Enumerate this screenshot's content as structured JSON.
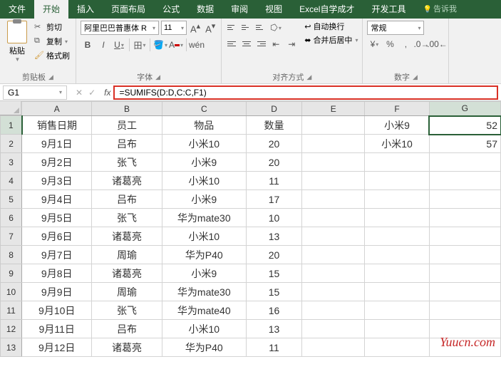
{
  "tabs": {
    "file": "文件",
    "home": "开始",
    "insert": "插入",
    "layout": "页面布局",
    "formulas": "公式",
    "data": "数据",
    "review": "审阅",
    "view": "视图",
    "addin": "Excel自学成才",
    "dev": "开发工具",
    "tell": "告诉我"
  },
  "ribbon": {
    "paste": "粘贴",
    "cut": "剪切",
    "copy": "复制",
    "format_painter": "格式刷",
    "clipboard_label": "剪贴板",
    "font_name": "阿里巴巴普惠体 R",
    "font_size": "11",
    "font_label": "字体",
    "wrap": "自动换行",
    "merge": "合并后居中",
    "align_label": "对齐方式",
    "number_format": "常规",
    "number_label": "数字"
  },
  "formula_bar": {
    "name_box": "G1",
    "formula": "=SUMIFS(D:D,C:C,F1)"
  },
  "columns": [
    "A",
    "B",
    "C",
    "D",
    "E",
    "F",
    "G"
  ],
  "rows_header": [
    "1",
    "2",
    "3",
    "4",
    "5",
    "6",
    "7",
    "8",
    "9",
    "10",
    "11",
    "12",
    "13"
  ],
  "headers": {
    "a": "销售日期",
    "b": "员工",
    "c": "物品",
    "d": "数量"
  },
  "side": {
    "f1": "小米9",
    "g1": "52",
    "f2": "小米10",
    "g2": "57"
  },
  "data_rows": [
    {
      "date": "9月1日",
      "emp": "吕布",
      "item": "小米10",
      "qty": "20"
    },
    {
      "date": "9月2日",
      "emp": "张飞",
      "item": "小米9",
      "qty": "20"
    },
    {
      "date": "9月3日",
      "emp": "诸葛亮",
      "item": "小米10",
      "qty": "11"
    },
    {
      "date": "9月4日",
      "emp": "吕布",
      "item": "小米9",
      "qty": "17"
    },
    {
      "date": "9月5日",
      "emp": "张飞",
      "item": "华为mate30",
      "qty": "10"
    },
    {
      "date": "9月6日",
      "emp": "诸葛亮",
      "item": "小米10",
      "qty": "13"
    },
    {
      "date": "9月7日",
      "emp": "周瑜",
      "item": "华为P40",
      "qty": "20"
    },
    {
      "date": "9月8日",
      "emp": "诸葛亮",
      "item": "小米9",
      "qty": "15"
    },
    {
      "date": "9月9日",
      "emp": "周瑜",
      "item": "华为mate30",
      "qty": "15"
    },
    {
      "date": "9月10日",
      "emp": "张飞",
      "item": "华为mate40",
      "qty": "16"
    },
    {
      "date": "9月11日",
      "emp": "吕布",
      "item": "小米10",
      "qty": "13"
    },
    {
      "date": "9月12日",
      "emp": "诸葛亮",
      "item": "华为P40",
      "qty": "11"
    }
  ],
  "watermark": "Yuucn.com"
}
